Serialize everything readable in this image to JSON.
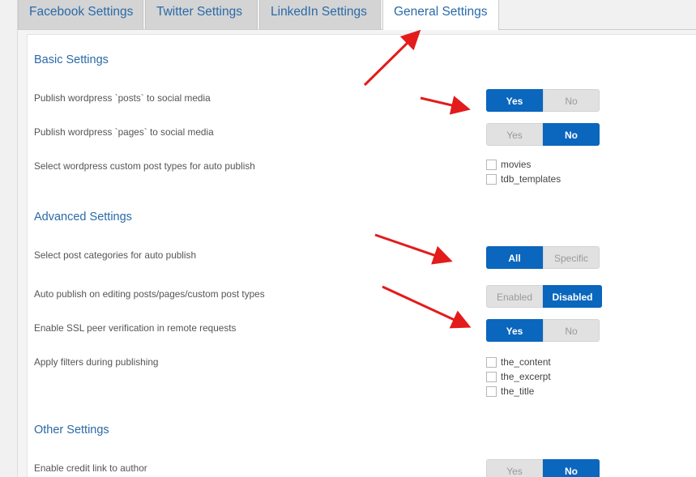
{
  "tabs": [
    {
      "label": "Facebook Settings",
      "active": false
    },
    {
      "label": "Twitter Settings",
      "active": false
    },
    {
      "label": "LinkedIn Settings",
      "active": false
    },
    {
      "label": "General Settings",
      "active": true
    }
  ],
  "sections": {
    "basic": {
      "title": "Basic Settings",
      "publish_posts": {
        "label": "Publish wordpress `posts` to social media",
        "options": [
          "Yes",
          "No"
        ],
        "selected": "Yes"
      },
      "publish_pages": {
        "label": "Publish wordpress `pages` to social media",
        "options": [
          "Yes",
          "No"
        ],
        "selected": "No"
      },
      "custom_post_types": {
        "label": "Select wordpress custom post types for auto publish",
        "options": [
          {
            "label": "movies",
            "checked": false
          },
          {
            "label": "tdb_templates",
            "checked": false
          }
        ]
      }
    },
    "advanced": {
      "title": "Advanced Settings",
      "post_categories": {
        "label": "Select post categories for auto publish",
        "options": [
          "All",
          "Specific"
        ],
        "selected": "All"
      },
      "auto_publish_editing": {
        "label": "Auto publish on editing posts/pages/custom post types",
        "options": [
          "Enabled",
          "Disabled"
        ],
        "selected": "Disabled"
      },
      "ssl_verification": {
        "label": "Enable SSL peer verification in remote requests",
        "options": [
          "Yes",
          "No"
        ],
        "selected": "Yes"
      },
      "filters": {
        "label": "Apply filters during publishing",
        "options": [
          {
            "label": "the_content",
            "checked": false
          },
          {
            "label": "the_excerpt",
            "checked": false
          },
          {
            "label": "the_title",
            "checked": false
          }
        ]
      }
    },
    "other": {
      "title": "Other Settings",
      "credit_link": {
        "label": "Enable credit link to author",
        "options": [
          "Yes",
          "No"
        ],
        "selected": "No"
      }
    }
  },
  "colors": {
    "accent": "#0b66bd",
    "heading": "#2b6aa6",
    "annotation_arrow": "#e31b1b"
  }
}
